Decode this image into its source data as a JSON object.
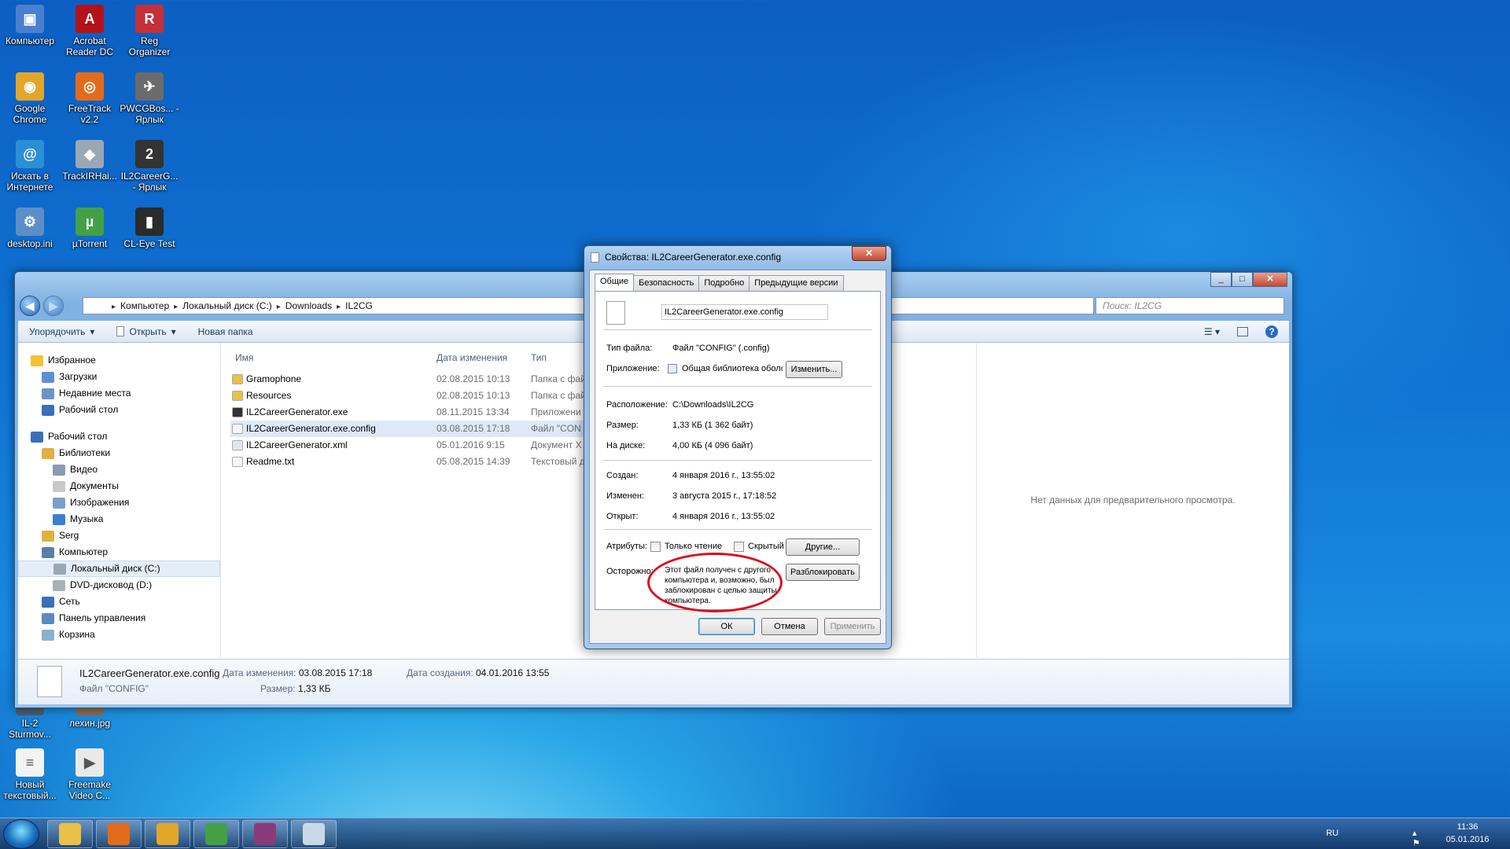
{
  "desktop": {
    "icons": [
      {
        "label": "Компьютер",
        "color": "#4a7fd0",
        "glyph": "▣"
      },
      {
        "label": "Acrobat Reader DC",
        "color": "#b3121b",
        "glyph": "A"
      },
      {
        "label": "Reg Organizer",
        "color": "#c4303a",
        "glyph": "R"
      },
      {
        "label": "Google Chrome",
        "color": "#e2a62a",
        "glyph": "◉"
      },
      {
        "label": "FreeTrack v2.2",
        "color": "#e36b1c",
        "glyph": "◎"
      },
      {
        "label": "PWCGBos... - Ярлык",
        "color": "#6b6b6b",
        "glyph": "✈"
      },
      {
        "label": "Искать в Интернете",
        "color": "#2c8fd6",
        "glyph": "@"
      },
      {
        "label": "TrackIRHai...",
        "color": "#9aa7b5",
        "glyph": "◆"
      },
      {
        "label": "IL2CareerG... - Ярлык",
        "color": "#333333",
        "glyph": "2"
      },
      {
        "label": "desktop.ini",
        "color": "#5d8ec6",
        "glyph": "⚙"
      },
      {
        "label": "µTorrent",
        "color": "#43a047",
        "glyph": "µ"
      },
      {
        "label": "CL-Eye Test",
        "color": "#2b2b2b",
        "glyph": "▮"
      },
      {
        "label": "IL-2 Sturmov...",
        "color": "#4a5b6c",
        "glyph": "✈"
      },
      {
        "label": "лехин.jpg",
        "color": "#8a6a4a",
        "glyph": "▨"
      },
      {
        "label": "Новый текстовый...",
        "color": "#f3f3f3",
        "glyph": "≡"
      },
      {
        "label": "Freemake Video C...",
        "color": "#e9e9e9",
        "glyph": "▶"
      }
    ]
  },
  "explorer": {
    "address": [
      "Компьютер",
      "Локальный диск (C:)",
      "Downloads",
      "IL2CG"
    ],
    "search_placeholder": "Поиск: IL2CG",
    "toolbar": {
      "organize": "Упорядочить",
      "open": "Открыть",
      "new_folder": "Новая папка"
    },
    "nav": [
      {
        "label": "Избранное",
        "indent": 0,
        "color": "#f2c230"
      },
      {
        "label": "Загрузки",
        "indent": 1,
        "color": "#5e8fd0"
      },
      {
        "label": "Недавние места",
        "indent": 1,
        "color": "#6c93c8"
      },
      {
        "label": "Рабочий стол",
        "indent": 1,
        "color": "#3a6fb8"
      },
      {
        "label": "Рабочий стол",
        "indent": 0,
        "color": "#3a6fb8",
        "gap": true
      },
      {
        "label": "Библиотеки",
        "indent": 1,
        "color": "#e0b040"
      },
      {
        "label": "Видео",
        "indent": 2,
        "color": "#8a9ab0"
      },
      {
        "label": "Документы",
        "indent": 2,
        "color": "#c9c9c9"
      },
      {
        "label": "Изображения",
        "indent": 2,
        "color": "#7aa0c8"
      },
      {
        "label": "Музыка",
        "indent": 2,
        "color": "#3a80d0"
      },
      {
        "label": "Serg",
        "indent": 1,
        "color": "#e0b040"
      },
      {
        "label": "Компьютер",
        "indent": 1,
        "color": "#5a7fa8"
      },
      {
        "label": "Локальный диск (C:)",
        "indent": 2,
        "color": "#9aa8b8",
        "selected": true
      },
      {
        "label": "DVD-дисковод (D:)",
        "indent": 2,
        "color": "#a8b0b8"
      },
      {
        "label": "Сеть",
        "indent": 1,
        "color": "#3a70b8"
      },
      {
        "label": "Панель управления",
        "indent": 1,
        "color": "#5a8ac0"
      },
      {
        "label": "Корзина",
        "indent": 1,
        "color": "#8ab0d0"
      }
    ],
    "columns": {
      "name": "Имя",
      "date": "Дата изменения",
      "type": "Тип"
    },
    "files": [
      {
        "name": "Gramophone",
        "date": "02.08.2015 10:13",
        "type": "Папка с фай",
        "color": "#e8c04a"
      },
      {
        "name": "Resources",
        "date": "02.08.2015 10:13",
        "type": "Папка с фай",
        "color": "#e8c04a"
      },
      {
        "name": "IL2CareerGenerator.exe",
        "date": "08.11.2015 13:34",
        "type": "Приложени",
        "color": "#333333"
      },
      {
        "name": "IL2CareerGenerator.exe.config",
        "date": "03.08.2015 17:18",
        "type": "Файл \"CON",
        "color": "#f6f6f6",
        "selected": true
      },
      {
        "name": "IL2CareerGenerator.xml",
        "date": "05.01.2016 9:15",
        "type": "Документ X",
        "color": "#dfe8f2"
      },
      {
        "name": "Readme.txt",
        "date": "05.08.2015 14:39",
        "type": "Текстовый д",
        "color": "#f6f6f6"
      }
    ],
    "preview_text": "Нет данных для предварительного просмотра.",
    "details": {
      "filename": "IL2CareerGenerator.exe.config",
      "filetype": "Файл \"CONFIG\"",
      "modified_label": "Дата изменения:",
      "modified": "03.08.2015 17:18",
      "size_label": "Размер:",
      "size": "1,33 КБ",
      "created_label": "Дата создания:",
      "created": "04.01.2016 13:55"
    }
  },
  "dialog": {
    "title": "Свойства: IL2CareerGenerator.exe.config",
    "tabs": [
      "Общие",
      "Безопасность",
      "Подробно",
      "Предыдущие версии"
    ],
    "filename": "IL2CareerGenerator.exe.config",
    "filetype_label": "Тип файла:",
    "filetype": "Файл \"CONFIG\" (.config)",
    "app_label": "Приложение:",
    "app": "Общая библиотека оболочки Wi",
    "change_btn": "Изменить...",
    "location_label": "Расположение:",
    "location": "C:\\Downloads\\IL2CG",
    "size_label": "Размер:",
    "size": "1,33 КБ (1 362 байт)",
    "ondisk_label": "На диске:",
    "ondisk": "4,00 КБ (4 096 байт)",
    "created_label": "Создан:",
    "created": "4 января 2016 г., 13:55:02",
    "modified_label": "Изменен:",
    "modified": "3 августа 2015 г., 17:18:52",
    "opened_label": "Открыт:",
    "opened": "4 января 2016 г., 13:55:02",
    "attr_label": "Атрибуты:",
    "readonly": "Только чтение",
    "hidden": "Скрытый",
    "other_btn": "Другие...",
    "caution_label": "Осторожно:",
    "caution_text": "Этот файл получен с другого компьютера и, возможно, был заблокирован с целью защиты компьютера.",
    "unblock_btn": "Разблокировать",
    "ok": "ОК",
    "cancel": "Отмена",
    "apply": "Применить"
  },
  "taskbar": {
    "apps": [
      {
        "name": "explorer",
        "color": "#e8c04a"
      },
      {
        "name": "media-player",
        "color": "#e36b1c"
      },
      {
        "name": "chrome",
        "color": "#e2a62a"
      },
      {
        "name": "utorrent",
        "color": "#43a047"
      },
      {
        "name": "winrar",
        "color": "#8a3a7a"
      },
      {
        "name": "paint",
        "color": "#c9d8e8"
      }
    ],
    "lang": "RU",
    "time": "11:36",
    "date": "05.01.2016"
  }
}
